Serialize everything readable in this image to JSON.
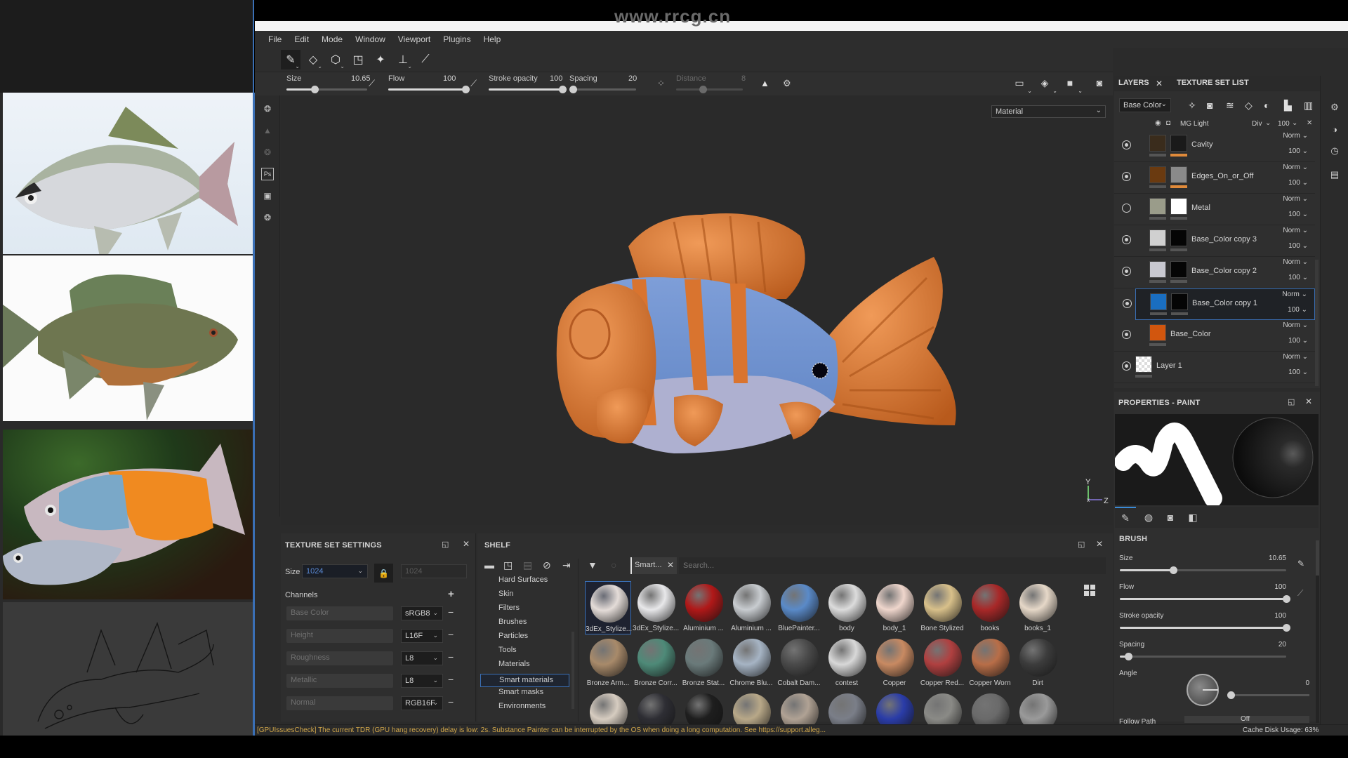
{
  "watermark": "www.rrcg.cn",
  "menu": [
    "File",
    "Edit",
    "Mode",
    "Window",
    "Viewport",
    "Plugins",
    "Help"
  ],
  "toolbar": {
    "tools": [
      {
        "name": "paint-brush",
        "icon": "✎",
        "active": true,
        "has_menu": true
      },
      {
        "name": "eraser",
        "icon": "◇",
        "active": false,
        "has_menu": true
      },
      {
        "name": "projection",
        "icon": "⬡",
        "active": false,
        "has_menu": true
      },
      {
        "name": "polygon-fill",
        "icon": "◳",
        "active": false,
        "has_menu": false
      },
      {
        "name": "smudge",
        "icon": "✦",
        "active": false,
        "has_menu": false
      },
      {
        "name": "clone-stamp",
        "icon": "⊥",
        "active": false,
        "has_menu": true
      },
      {
        "name": "color-picker",
        "icon": "⟋",
        "active": false,
        "has_menu": false
      }
    ]
  },
  "brushbar": {
    "size": {
      "label": "Size",
      "value": "10.65",
      "fraction": 0.35
    },
    "flow": {
      "label": "Flow",
      "value": "100",
      "fraction": 1.0
    },
    "stroke_opacity": {
      "label": "Stroke opacity",
      "value": "100",
      "fraction": 1.0
    },
    "spacing": {
      "label": "Spacing",
      "value": "20",
      "fraction": 0.05
    },
    "distance": {
      "label": "Distance",
      "value": "8",
      "fraction": 0.4,
      "disabled": true
    }
  },
  "viewport": {
    "material_mode": "Material",
    "axis": {
      "y": "Y",
      "x": "x",
      "z": "Z"
    },
    "colors": {
      "orange": "#d9742f",
      "blue": "#6e92d0",
      "belly": "#a9abcc",
      "bg": "#2a2a2a"
    }
  },
  "texture_set_settings": {
    "title": "TEXTURE SET SETTINGS",
    "size_label": "Size",
    "size_value": "1024",
    "size_linked_value": "1024",
    "channels_label": "Channels",
    "channels": [
      {
        "name": "Base Color",
        "format": "sRGB8"
      },
      {
        "name": "Height",
        "format": "L16F"
      },
      {
        "name": "Roughness",
        "format": "L8"
      },
      {
        "name": "Metallic",
        "format": "L8"
      },
      {
        "name": "Normal",
        "format": "RGB16F"
      }
    ]
  },
  "shelf": {
    "title": "SHELF",
    "categories": [
      "Hard Surfaces",
      "Skin",
      "Filters",
      "Brushes",
      "Particles",
      "Tools",
      "Materials",
      "Smart materials",
      "Smart masks",
      "Environments"
    ],
    "selected_category": "Smart materials",
    "filter_chip": "Smart...",
    "search_placeholder": "Search...",
    "materials": [
      {
        "label": "3dEx_Stylize...",
        "color": "#e4dcd8",
        "selected": true
      },
      {
        "label": "3dEx_Stylize...",
        "color": "#e8e8ea",
        "selected": false
      },
      {
        "label": "Aluminium ...",
        "color": "#b01818",
        "selected": false
      },
      {
        "label": "Aluminium ...",
        "color": "#c8ccd0",
        "selected": false
      },
      {
        "label": "BluePainter...",
        "color": "#5a8ac8",
        "selected": false
      },
      {
        "label": "body",
        "color": "#dcdcdc",
        "selected": false
      },
      {
        "label": "body_1",
        "color": "#efd6cc",
        "selected": false
      },
      {
        "label": "Bone Stylized",
        "color": "#d8c08a",
        "selected": false
      },
      {
        "label": "books",
        "color": "#a82828",
        "selected": false
      },
      {
        "label": "books_1",
        "color": "#e6d8c8",
        "selected": false
      },
      {
        "label": "Bronze Arm...",
        "color": "#a88a6a",
        "selected": false
      },
      {
        "label": "Bronze Corr...",
        "color": "#4e8a78",
        "selected": false
      },
      {
        "label": "Bronze Stat...",
        "color": "#6a7a7a",
        "selected": false
      },
      {
        "label": "Chrome Blu...",
        "color": "#a6b4c4",
        "selected": false
      },
      {
        "label": "Cobalt Dam...",
        "color": "#4a4a4a",
        "selected": false
      },
      {
        "label": "contest",
        "color": "#d8d8d8",
        "selected": false
      },
      {
        "label": "Copper",
        "color": "#c88a62",
        "selected": false
      },
      {
        "label": "Copper Red...",
        "color": "#b04040",
        "selected": false
      },
      {
        "label": "Copper Worn",
        "color": "#b86e48",
        "selected": false
      },
      {
        "label": "Dirt",
        "color": "#3c3c3c",
        "selected": false
      },
      {
        "label": "",
        "color": "#d6ccc0",
        "selected": false
      },
      {
        "label": "",
        "color": "#2e2e34",
        "selected": false
      },
      {
        "label": "",
        "color": "#1e1e1e",
        "selected": false
      },
      {
        "label": "",
        "color": "#b8a888",
        "selected": false
      },
      {
        "label": "",
        "color": "#b0a294",
        "selected": false
      },
      {
        "label": "",
        "color": "#7a7e88",
        "selected": false
      },
      {
        "label": "",
        "color": "#2a3ca8",
        "selected": false
      },
      {
        "label": "",
        "color": "#8a8a86",
        "selected": false
      },
      {
        "label": "",
        "color": "#6a6a6a",
        "selected": false
      },
      {
        "label": "",
        "color": "#9a9a9a",
        "selected": false
      }
    ]
  },
  "layers": {
    "tabs": [
      "LAYERS",
      "TEXTURE SET LIST"
    ],
    "active_tab": "LAYERS",
    "channel": "Base Color",
    "mask_generator": {
      "name": "MG Light",
      "blend": "Div",
      "opacity": "100"
    },
    "items": [
      {
        "name": "Cavity",
        "blend": "Norm",
        "opacity": "100",
        "visible": true,
        "fill": "#3a2c1c",
        "mask": "#1a1a1a",
        "has_mask": true,
        "selected": false
      },
      {
        "name": "Edges_On_or_Off",
        "blend": "Norm",
        "opacity": "100",
        "visible": true,
        "fill": "#6a3a10",
        "mask": "#8a8a8a",
        "has_mask": true,
        "selected": false
      },
      {
        "name": "Metal",
        "blend": "Norm",
        "opacity": "100",
        "visible": false,
        "fill": "#9a9c8a",
        "mask": "#ffffff",
        "has_mask": true,
        "selected": false
      },
      {
        "name": "Base_Color copy 3",
        "blend": "Norm",
        "opacity": "100",
        "visible": true,
        "fill": "#d0d0d0",
        "mask": "#050505",
        "has_mask": true,
        "selected": false
      },
      {
        "name": "Base_Color copy 2",
        "blend": "Norm",
        "opacity": "100",
        "visible": true,
        "fill": "#c8c8d0",
        "mask": "#050505",
        "has_mask": true,
        "selected": false
      },
      {
        "name": "Base_Color copy 1",
        "blend": "Norm",
        "opacity": "100",
        "visible": true,
        "fill": "#1a6ec0",
        "mask": "#050505",
        "has_mask": true,
        "selected": true
      },
      {
        "name": "Base_Color",
        "blend": "Norm",
        "opacity": "100",
        "visible": true,
        "fill": "#d2560e",
        "mask": "",
        "has_mask": false,
        "selected": false
      },
      {
        "name": "Layer 1",
        "blend": "Norm",
        "opacity": "100",
        "visible": true,
        "fill": "checker",
        "mask": "",
        "has_mask": false,
        "selected": false
      }
    ]
  },
  "properties": {
    "title": "PROPERTIES - PAINT",
    "section": "BRUSH",
    "size": {
      "label": "Size",
      "value": "10.65",
      "fraction": 0.32
    },
    "flow": {
      "label": "Flow",
      "value": "100",
      "fraction": 1.0
    },
    "stroke_opacity": {
      "label": "Stroke opacity",
      "value": "100",
      "fraction": 1.0
    },
    "spacing": {
      "label": "Spacing",
      "value": "20",
      "fraction": 0.05
    },
    "angle": {
      "label": "Angle",
      "value": "0"
    },
    "follow_path": {
      "label": "Follow Path",
      "value": "Off"
    }
  },
  "status": {
    "message": "[GPUIssuesCheck] The current TDR (GPU hang recovery) delay is low: 2s. Substance Painter can be interrupted by the OS when doing a long computation. See https://support.alleg...",
    "cache_label": "Cache Disk Usage:",
    "cache_value": "63%"
  }
}
